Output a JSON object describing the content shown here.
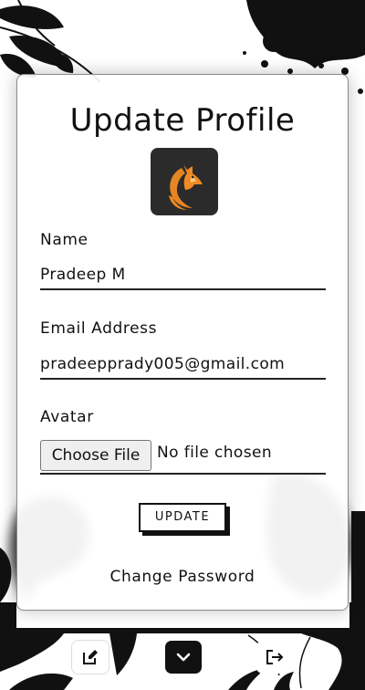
{
  "page": {
    "title": "Update Profile"
  },
  "form": {
    "name_label": "Name",
    "name_value": "Pradeep M",
    "email_label": "Email Address",
    "email_value": "pradeepprady005@gmail.com",
    "avatar_label": "Avatar",
    "file_button_label": "Choose File",
    "file_status": "No file chosen",
    "update_label": "UPDATE",
    "change_password_label": "Change Password"
  },
  "bottom_nav": {
    "icons": [
      "edit-icon",
      "chevron-down-icon",
      "logout-icon"
    ]
  },
  "logo": {
    "icon": "fox-logo"
  },
  "colors": {
    "accent": "#f08a24",
    "dark": "#111111",
    "card_bg": "#ffffff",
    "logo_bg": "#2b2b2b"
  }
}
